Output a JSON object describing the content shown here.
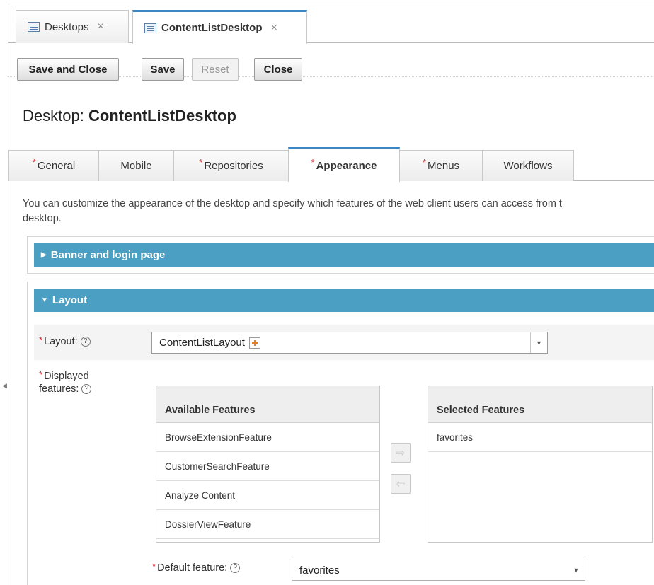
{
  "tabs": [
    {
      "label": "Desktops",
      "close": "×"
    },
    {
      "label": "ContentListDesktop",
      "close": "×"
    }
  ],
  "toolbar": {
    "save_close": "Save and Close",
    "save": "Save",
    "reset": "Reset",
    "close": "Close"
  },
  "title": {
    "prefix": "Desktop: ",
    "name": "ContentListDesktop"
  },
  "settings_tabs": [
    {
      "label": "General",
      "required": true
    },
    {
      "label": "Mobile",
      "required": false
    },
    {
      "label": "Repositories",
      "required": true
    },
    {
      "label": "Appearance",
      "required": true,
      "active": true
    },
    {
      "label": "Menus",
      "required": true
    },
    {
      "label": "Workflows",
      "required": false
    }
  ],
  "description": {
    "line1": "You can customize the appearance of the desktop and specify which features of the web client users can access from t",
    "line2": "desktop."
  },
  "sections": {
    "banner": {
      "title": "Banner and login page",
      "expanded": false
    },
    "layout": {
      "title": "Layout",
      "expanded": true
    }
  },
  "layout_field": {
    "label": "Layout:",
    "value": "ContentListLayout"
  },
  "features": {
    "label_line1": "Displayed",
    "label_line2": "features:",
    "available_header": "Available Features",
    "available": [
      "BrowseExtensionFeature",
      "CustomerSearchFeature",
      "Analyze Content",
      "DossierViewFeature"
    ],
    "selected_header": "Selected Features",
    "selected": [
      "favorites"
    ]
  },
  "default_feature": {
    "label": "Default feature:",
    "value": "favorites"
  },
  "required_mark": "*",
  "help_glyph": "?",
  "colors": {
    "accent": "#3d86c6",
    "section_header": "#4a9fc2",
    "required": "#d2232a"
  }
}
